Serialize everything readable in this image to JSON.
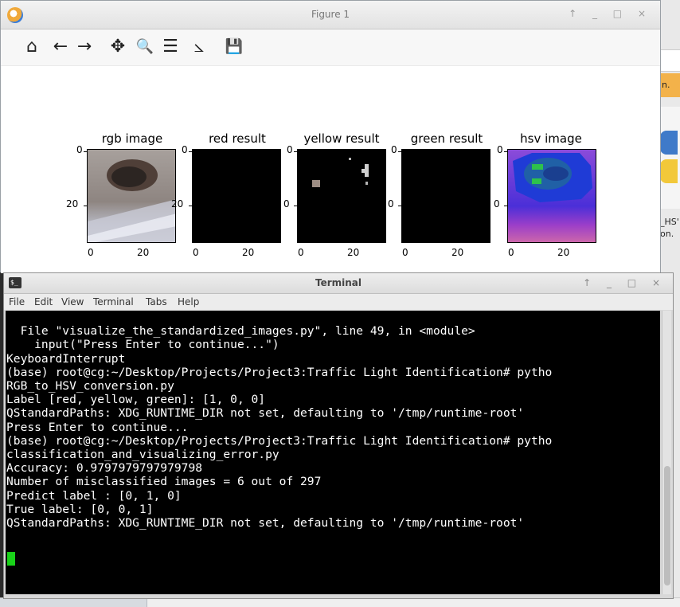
{
  "figure": {
    "title": "Figure 1",
    "window_controls": "↑ _ □ ×",
    "toolbar": {
      "home": "⌂",
      "back": "←",
      "forward": "→",
      "pan": "✥",
      "zoom": "🔍",
      "configure": "☰",
      "edit_axes": "⦣",
      "save": "💾"
    },
    "subplots": [
      {
        "title": "rgb image"
      },
      {
        "title": "red result"
      },
      {
        "title": "yellow result"
      },
      {
        "title": "green result"
      },
      {
        "title": "hsv image"
      }
    ],
    "ytick_labels": [
      "0",
      "20"
    ],
    "xtick_labels": [
      "0",
      "20"
    ]
  },
  "background_snippets": {
    "a": "n.",
    "b": "_HS'",
    "c": "on."
  },
  "terminal": {
    "title": "Terminal",
    "window_controls": "↑ _ □ ×",
    "menu": [
      "File",
      "Edit",
      "View",
      "Terminal",
      "Tabs",
      "Help"
    ],
    "lines": [
      "  File \"visualize_the_standardized_images.py\", line 49, in <module>",
      "    input(\"Press Enter to continue...\")",
      "KeyboardInterrupt",
      "(base) root@cg:~/Desktop/Projects/Project3:Traffic Light Identification# pytho",
      "RGB_to_HSV_conversion.py",
      "Label [red, yellow, green]: [1, 0, 0]",
      "QStandardPaths: XDG_RUNTIME_DIR not set, defaulting to '/tmp/runtime-root'",
      "Press Enter to continue...",
      "(base) root@cg:~/Desktop/Projects/Project3:Traffic Light Identification# pytho",
      "classification_and_visualizing_error.py",
      "Accuracy: 0.9797979797979798",
      "Number of misclassified images = 6 out of 297",
      "Predict label : [0, 1, 0]",
      "True label: [0, 0, 1]",
      "QStandardPaths: XDG_RUNTIME_DIR not set, defaulting to '/tmp/runtime-root'"
    ]
  },
  "colors": {
    "cursor": "#19d219",
    "terminal_bg": "#000000",
    "terminal_fg": "#ffffff"
  }
}
